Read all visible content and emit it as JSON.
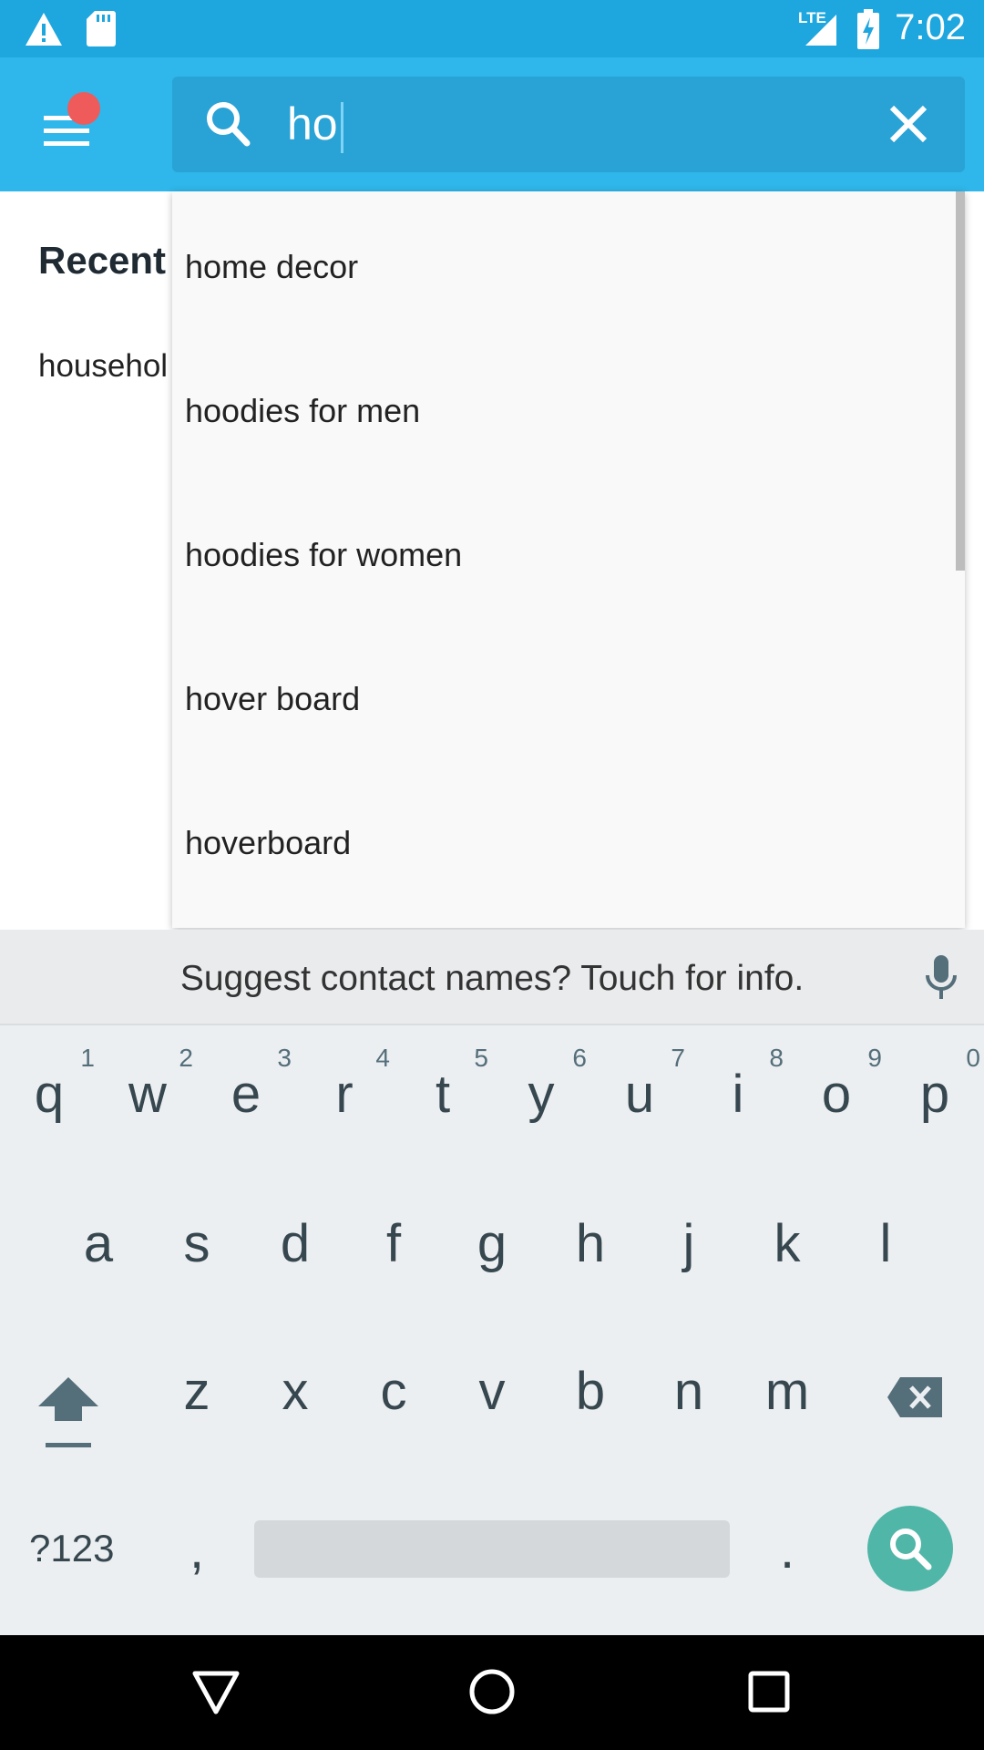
{
  "status_bar": {
    "time": "7:02",
    "network": "LTE",
    "icons": [
      "warning-icon",
      "sd-card-icon",
      "signal-icon",
      "battery-charging-icon"
    ]
  },
  "search": {
    "query": "ho"
  },
  "recent": {
    "title": "Recent",
    "items": [
      "househol"
    ]
  },
  "suggestions": [
    "home decor",
    "hoodies for men",
    "hoodies for women",
    "hover board",
    "hoverboard"
  ],
  "keyboard": {
    "suggestion_text": "Suggest contact names? Touch for info.",
    "row1": [
      {
        "key": "q",
        "hint": "1"
      },
      {
        "key": "w",
        "hint": "2"
      },
      {
        "key": "e",
        "hint": "3"
      },
      {
        "key": "r",
        "hint": "4"
      },
      {
        "key": "t",
        "hint": "5"
      },
      {
        "key": "y",
        "hint": "6"
      },
      {
        "key": "u",
        "hint": "7"
      },
      {
        "key": "i",
        "hint": "8"
      },
      {
        "key": "o",
        "hint": "9"
      },
      {
        "key": "p",
        "hint": "0"
      }
    ],
    "row2": [
      "a",
      "s",
      "d",
      "f",
      "g",
      "h",
      "j",
      "k",
      "l"
    ],
    "row3": [
      "z",
      "x",
      "c",
      "v",
      "b",
      "n",
      "m"
    ],
    "symbols_label": "?123",
    "comma": ",",
    "period": "."
  },
  "colors": {
    "status_bar": "#1ea6de",
    "app_bar": "#2fb6ea",
    "badge": "#ef5b5b",
    "search_key": "#4fb6a8"
  }
}
